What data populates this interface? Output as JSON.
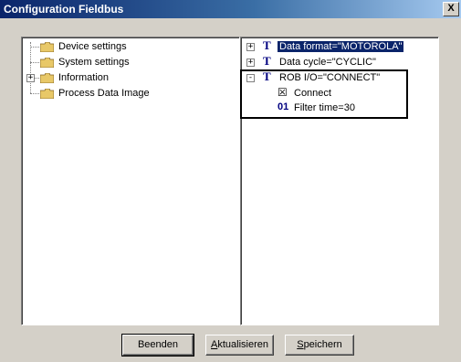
{
  "window": {
    "title": "Configuration Fieldbus",
    "close_glyph": "X"
  },
  "left_tree": {
    "items": [
      {
        "label": "Device settings",
        "icon": "folder-icon"
      },
      {
        "label": "System settings",
        "icon": "folder-icon"
      },
      {
        "label": "Information",
        "icon": "folder-icon",
        "expander": "+"
      },
      {
        "label": "Process Data Image",
        "icon": "folder-icon"
      }
    ]
  },
  "right_tree": {
    "items": [
      {
        "expander": "+",
        "type_glyph": "T",
        "label": "Data format=\"MOTOROLA\"",
        "selected": true
      },
      {
        "expander": "+",
        "type_glyph": "T",
        "label": "Data cycle=\"CYCLIC\""
      },
      {
        "expander": "-",
        "type_glyph": "T",
        "label": "ROB I/O=\"CONNECT\""
      }
    ],
    "children": [
      {
        "glyph": "☒",
        "label": "Connect"
      },
      {
        "glyph": "01",
        "label": "Filter time=30"
      }
    ]
  },
  "buttons": {
    "close_label": "Beenden",
    "refresh_label_prefix": "A",
    "refresh_label_rest": "ktualisieren",
    "save_label_prefix": "S",
    "save_label_rest": "peichern"
  }
}
